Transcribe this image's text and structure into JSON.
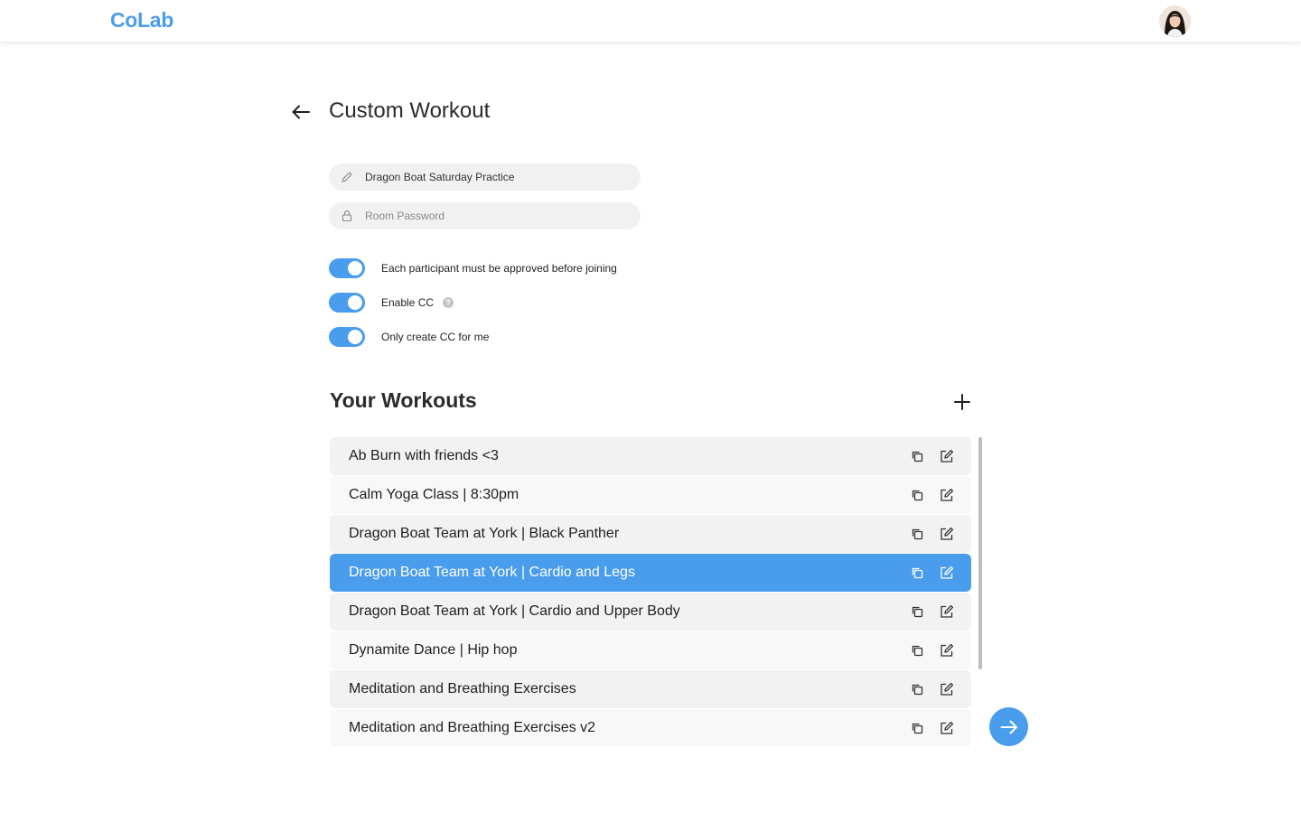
{
  "app": {
    "logo": "CoLab"
  },
  "colors": {
    "accent": "#4a9ced",
    "logo": "#4a9ced",
    "row_odd": "#f2f2f2",
    "row_even": "#f8f8f8"
  },
  "header": {
    "avatar_icon": "user-avatar"
  },
  "page": {
    "title": "Custom Workout",
    "back_icon": "arrow-left-icon"
  },
  "form": {
    "name_value": "Dragon Boat Saturday Practice",
    "name_icon": "pencil-icon",
    "password_placeholder": "Room Password",
    "password_icon": "lock-icon"
  },
  "toggles": [
    {
      "label": "Each participant must be approved before joining",
      "on": true
    },
    {
      "label": "Enable CC",
      "on": true,
      "help": "?"
    },
    {
      "label": "Only create CC for me",
      "on": true
    }
  ],
  "workouts": {
    "title": "Your Workouts",
    "add_icon": "plus-icon",
    "selected_index": 3,
    "items": [
      {
        "name": "Ab Burn with friends <3"
      },
      {
        "name": "Calm Yoga Class | 8:30pm"
      },
      {
        "name": "Dragon Boat Team at York | Black Panther"
      },
      {
        "name": "Dragon Boat Team at York | Cardio and Legs"
      },
      {
        "name": "Dragon Boat Team at York | Cardio and Upper Body"
      },
      {
        "name": "Dynamite Dance | Hip hop"
      },
      {
        "name": "Meditation and Breathing Exercises"
      },
      {
        "name": "Meditation and Breathing Exercises v2"
      }
    ],
    "row_icons": [
      "copy-icon",
      "edit-icon"
    ]
  },
  "next_button": {
    "icon": "arrow-right-icon"
  }
}
